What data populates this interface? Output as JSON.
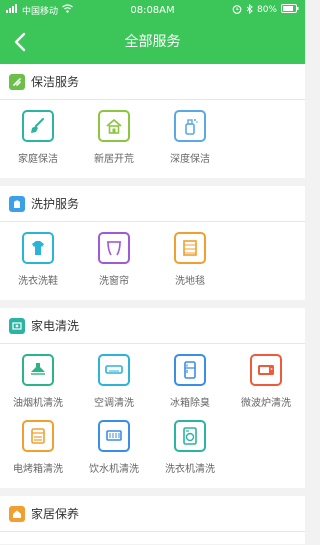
{
  "status_bar": {
    "carrier": "中国移动",
    "time": "08:08AM",
    "battery": "80%"
  },
  "nav": {
    "title": "全部服务"
  },
  "sections": [
    {
      "title": "保洁服务",
      "color": "#6cc04a",
      "items": [
        {
          "label": "家庭保洁",
          "icon": "broom-icon",
          "color": "#2bb3a3"
        },
        {
          "label": "新居开荒",
          "icon": "house-icon",
          "color": "#8cc63f"
        },
        {
          "label": "深度保洁",
          "icon": "spray-bottle-icon",
          "color": "#5aa9e6"
        }
      ]
    },
    {
      "title": "洗护服务",
      "color": "#3aa0e8",
      "items": [
        {
          "label": "洗衣洗鞋",
          "icon": "shirt-icon",
          "color": "#2bb3d8"
        },
        {
          "label": "洗窗帘",
          "icon": "curtain-icon",
          "color": "#a05ad8"
        },
        {
          "label": "洗地毯",
          "icon": "rug-icon",
          "color": "#f0a030"
        }
      ]
    },
    {
      "title": "家电清洗",
      "color": "#2bb3a3",
      "items": [
        {
          "label": "油烟机清洗",
          "icon": "range-hood-icon",
          "color": "#2bb38a"
        },
        {
          "label": "空调清洗",
          "icon": "air-conditioner-icon",
          "color": "#2bb3d8"
        },
        {
          "label": "冰箱除臭",
          "icon": "fridge-icon",
          "color": "#3a8ee8"
        },
        {
          "label": "微波炉清洗",
          "icon": "microwave-icon",
          "color": "#f05a3a"
        },
        {
          "label": "电烤箱清洗",
          "icon": "oven-icon",
          "color": "#f0a030"
        },
        {
          "label": "饮水机清洗",
          "icon": "water-dispenser-icon",
          "color": "#3a8ee8"
        },
        {
          "label": "洗衣机清洗",
          "icon": "washing-machine-icon",
          "color": "#2bb3a3"
        }
      ]
    },
    {
      "title": "家居保养",
      "color": "#f0a030",
      "items": []
    }
  ]
}
